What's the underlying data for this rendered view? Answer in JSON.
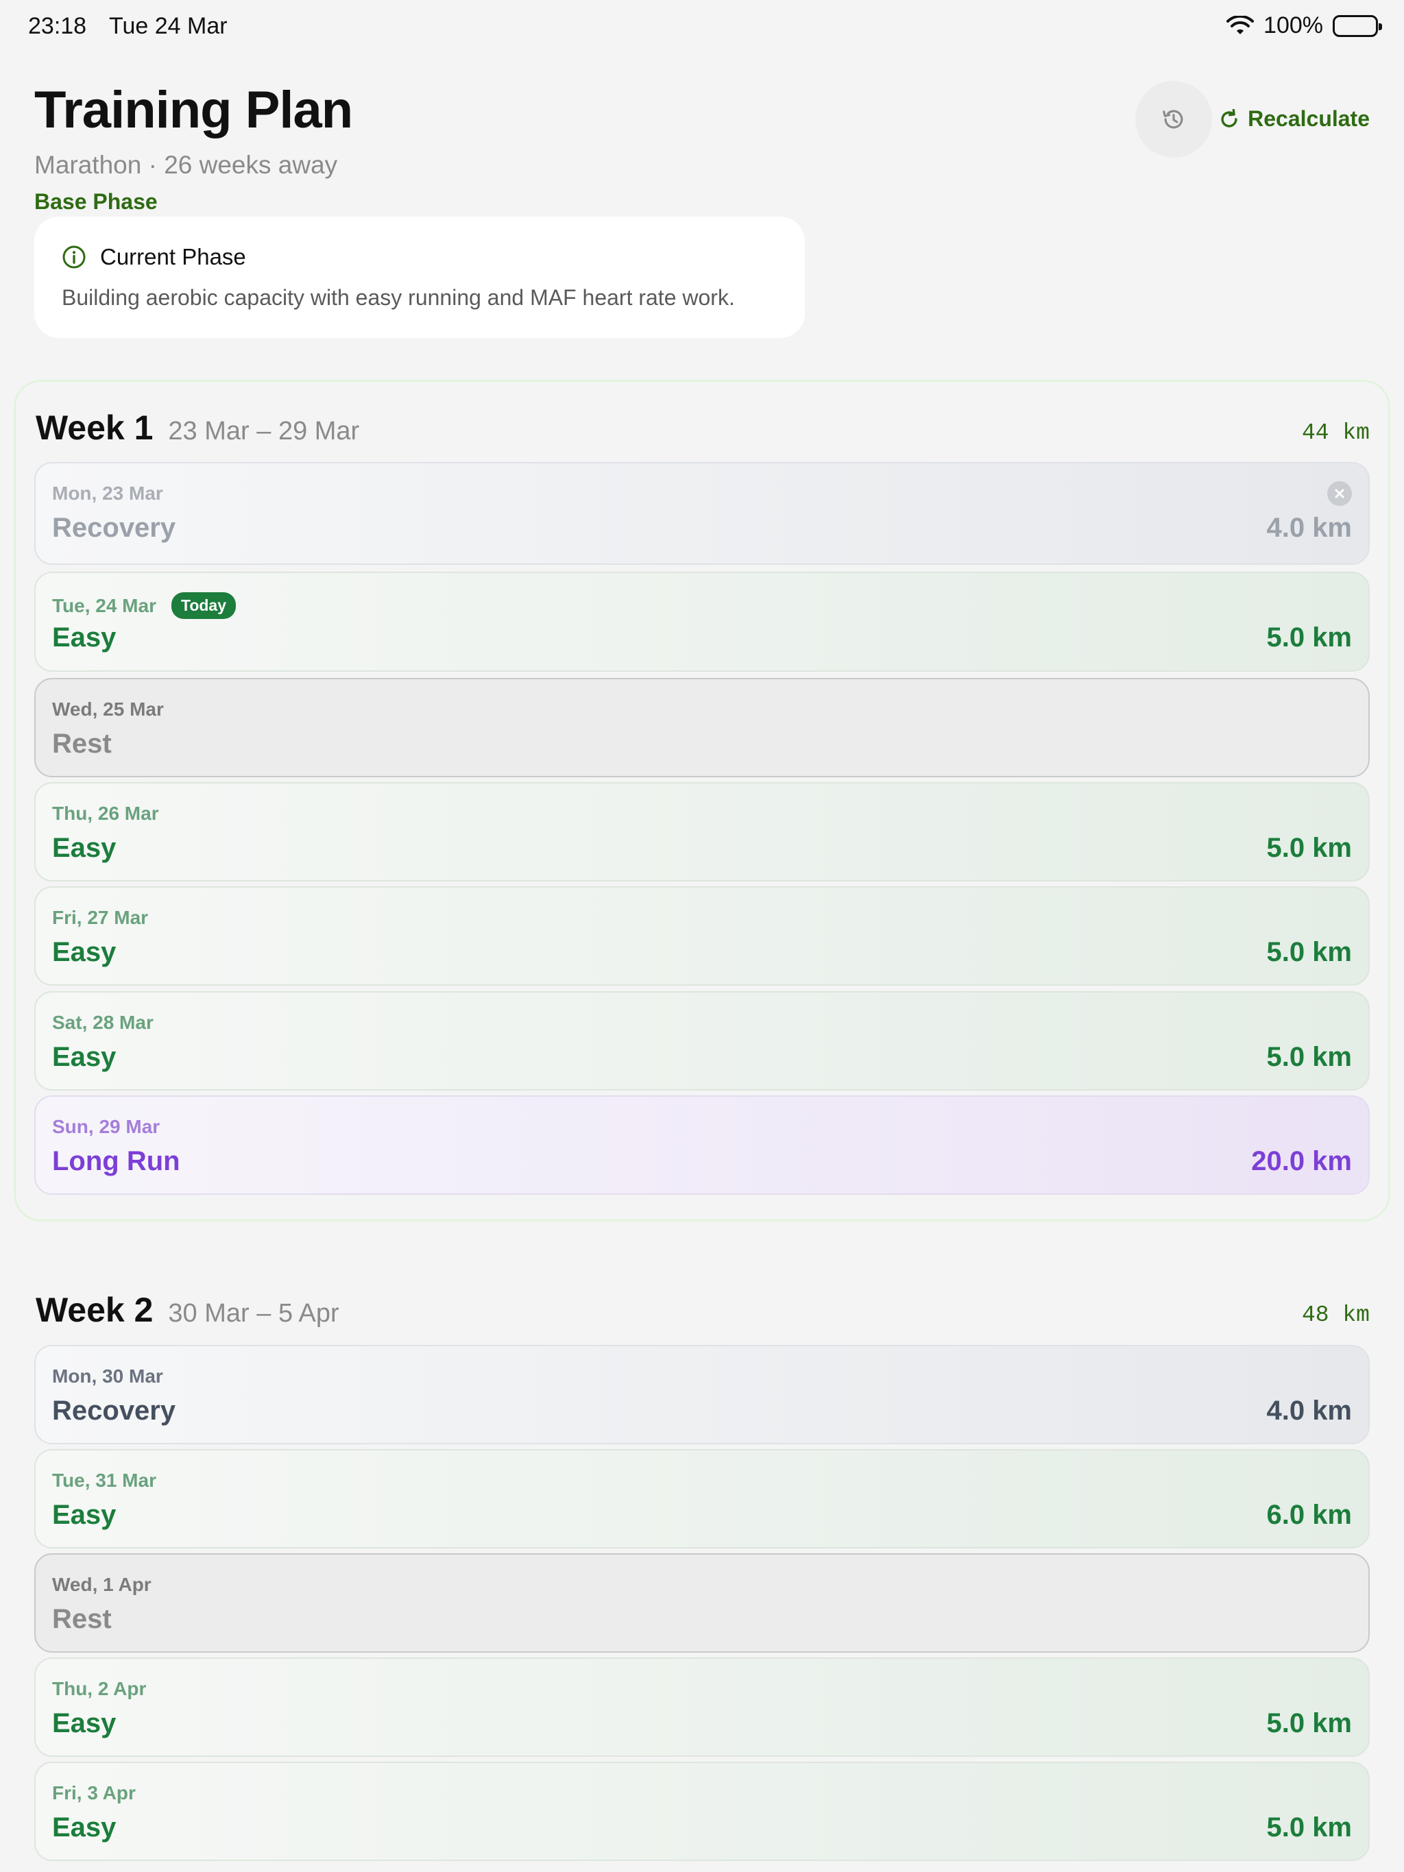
{
  "status_bar": {
    "time": "23:18",
    "date": "Tue 24 Mar",
    "battery": "100%"
  },
  "header": {
    "title": "Training Plan",
    "subtitle": "Marathon · 26 weeks away",
    "phase": "Base Phase",
    "recalculate_label": "Recalculate"
  },
  "phase_card": {
    "title": "Current Phase",
    "description": "Building aerobic capacity with easy running and MAF heart rate work."
  },
  "weeks": [
    {
      "title": "Week 1",
      "range": "23 Mar – 29 Mar",
      "total": "44  km",
      "days": [
        {
          "date": "Mon, 23 Mar",
          "type": "Recovery",
          "distance": "4.0 km"
        },
        {
          "date": "Tue, 24 Mar",
          "badge": "Today",
          "type": "Easy",
          "distance": "5.0 km"
        },
        {
          "date": "Wed, 25 Mar",
          "type": "Rest",
          "distance": ""
        },
        {
          "date": "Thu, 26 Mar",
          "type": "Easy",
          "distance": "5.0 km"
        },
        {
          "date": "Fri, 27 Mar",
          "type": "Easy",
          "distance": "5.0 km"
        },
        {
          "date": "Sat, 28 Mar",
          "type": "Easy",
          "distance": "5.0 km"
        },
        {
          "date": "Sun, 29 Mar",
          "type": "Long Run",
          "distance": "20.0 km"
        }
      ]
    },
    {
      "title": "Week 2",
      "range": "30 Mar – 5 Apr",
      "total": "48  km",
      "days": [
        {
          "date": "Mon, 30 Mar",
          "type": "Recovery",
          "distance": "4.0 km"
        },
        {
          "date": "Tue, 31 Mar",
          "type": "Easy",
          "distance": "6.0 km"
        },
        {
          "date": "Wed, 1 Apr",
          "type": "Rest",
          "distance": ""
        },
        {
          "date": "Thu, 2 Apr",
          "type": "Easy",
          "distance": "5.0 km"
        },
        {
          "date": "Fri, 3 Apr",
          "type": "Easy",
          "distance": "5.0 km"
        }
      ]
    }
  ]
}
